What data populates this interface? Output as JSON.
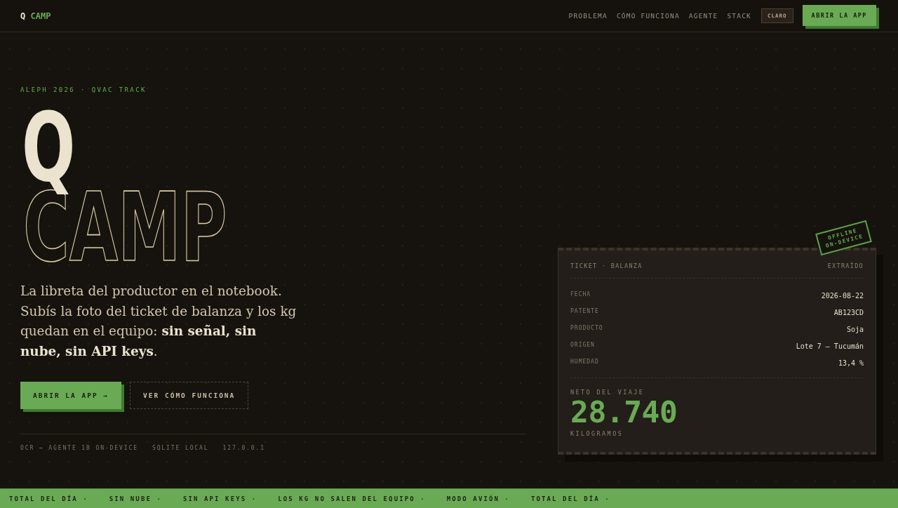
{
  "nav": {
    "logo": {
      "mark": "Q",
      "word": "CAMP"
    },
    "links": [
      "PROBLEMA",
      "CÓMO FUNCIONA",
      "AGENTE",
      "STACK"
    ],
    "theme_toggle": "CLARO",
    "cta": "ABRIR LA APP"
  },
  "hero": {
    "eyebrow": "ALEPH 2026 · QVAC TRACK",
    "title_letter": "Q",
    "title_word": "CAMP",
    "lead": "La libreta del productor en el notebook. Subís la foto del ticket de balanza y los kg quedan en el equipo: **sin señal, sin nube, sin API keys**.",
    "buttons": [
      {
        "label": "ABRIR LA APP →",
        "kind": "primary"
      },
      {
        "label": "VER CÓMO FUNCIONA",
        "kind": "secondary"
      }
    ],
    "meta": [
      "OCR → AGENTE 1B ON-DEVICE",
      "SQLITE LOCAL",
      "127.0.0.1"
    ]
  },
  "ticket": {
    "stamp": [
      "OFFLINE",
      "ON-DEVICE"
    ],
    "title": "TICKET · BALANZA",
    "status": "EXTRAÍDO",
    "fields": [
      {
        "label": "FECHA",
        "value": "2026-08-22"
      },
      {
        "label": "PATENTE",
        "value": "AB123CD"
      },
      {
        "label": "PRODUCTO",
        "value": "Soja"
      },
      {
        "label": "ORIGEN",
        "value": "Lote 7 — Tucumán"
      },
      {
        "label": "HUMEDAD",
        "value": "13,4 %"
      }
    ],
    "total_label": "NETO DEL VIAJE",
    "total": "28.740",
    "unit": "KILOGRAMOS"
  },
  "ticker": [
    "TOTAL DEL DÍA ·",
    "SIN NUBE ·",
    "SIN API KEYS ·",
    "LOS KG NO SALEN DEL EQUIPO ·",
    "MODO AVIÓN ·",
    "TOTAL DEL DÍA ·"
  ]
}
